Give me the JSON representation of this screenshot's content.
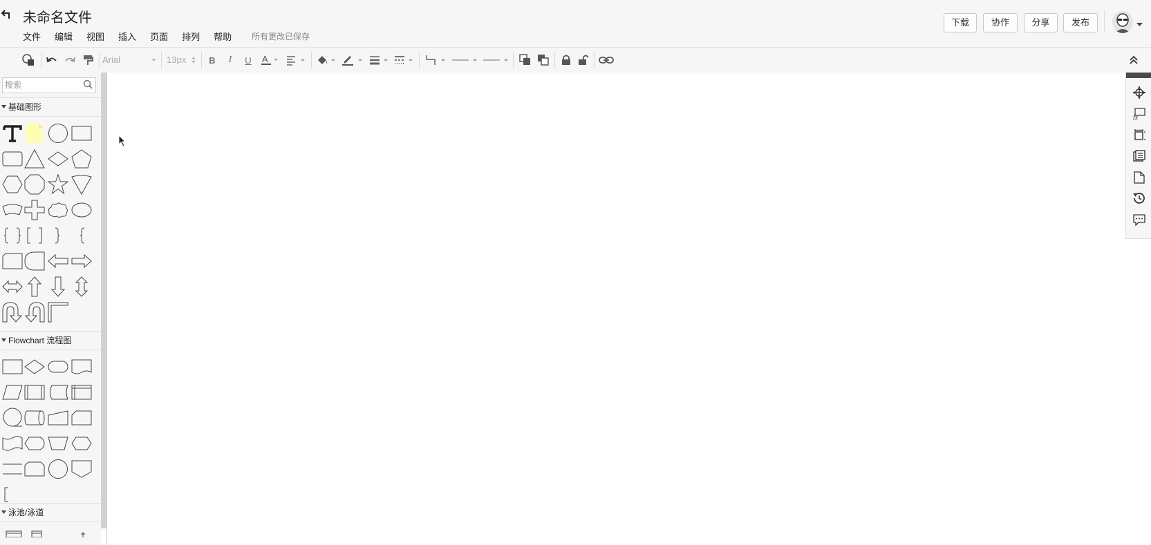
{
  "header": {
    "title": "未命名文件",
    "menu": [
      "文件",
      "编辑",
      "视图",
      "插入",
      "页面",
      "排列",
      "帮助"
    ],
    "saved_status": "所有更改已保存",
    "buttons": {
      "download": "下载",
      "collaborate": "协作",
      "share": "分享",
      "publish": "发布"
    }
  },
  "toolbar": {
    "font_family": "Arial",
    "font_size": "13px"
  },
  "sidebar": {
    "search_placeholder": "搜索",
    "categories": [
      "基础图形",
      "Flowchart 流程图",
      "泳池/泳道"
    ]
  },
  "colors": {
    "background": "#f6f6f6",
    "note_yellow": "#fffdb0",
    "border": "#cccccc"
  }
}
